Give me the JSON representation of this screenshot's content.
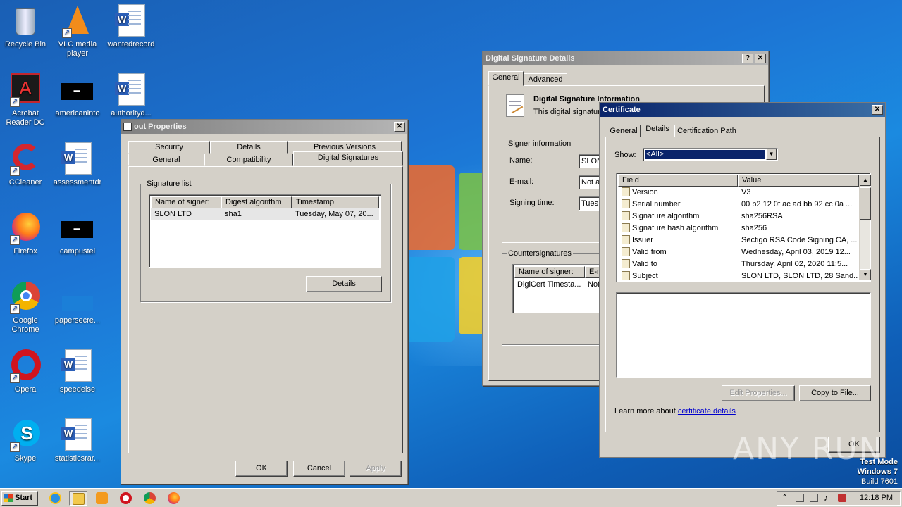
{
  "desktop": {
    "icons": [
      {
        "label": "Recycle Bin",
        "icon": "recycle-bin-icon"
      },
      {
        "label": "VLC media player",
        "icon": "vlc-icon"
      },
      {
        "label": "wantedrecord",
        "icon": "word-doc-icon"
      },
      {
        "label": "Acrobat Reader DC",
        "icon": "acrobat-icon"
      },
      {
        "label": "americaninto",
        "icon": "black-file-icon"
      },
      {
        "label": "authorityd...",
        "icon": "word-doc-icon"
      },
      {
        "label": "CCleaner",
        "icon": "ccleaner-icon"
      },
      {
        "label": "assessmentdr",
        "icon": "word-doc-icon"
      },
      {
        "label": "Firefox",
        "icon": "firefox-icon"
      },
      {
        "label": "campustel",
        "icon": "black-file-icon"
      },
      {
        "label": "Google Chrome",
        "icon": "chrome-icon"
      },
      {
        "label": "papersecre...",
        "icon": "blank-file-icon"
      },
      {
        "label": "Opera",
        "icon": "opera-icon"
      },
      {
        "label": "speedelse",
        "icon": "word-doc-icon"
      },
      {
        "label": "Skype",
        "icon": "skype-icon"
      },
      {
        "label": "statisticsrar...",
        "icon": "word-doc-icon"
      }
    ]
  },
  "props": {
    "title": "out Properties",
    "tabs_row1": [
      "Security",
      "Details",
      "Previous Versions"
    ],
    "tabs_row2": [
      "General",
      "Compatibility",
      "Digital Signatures"
    ],
    "sig_group": "Signature list",
    "columns": [
      "Name of signer:",
      "Digest algorithm",
      "Timestamp"
    ],
    "rows": [
      [
        "SLON LTD",
        "sha1",
        "Tuesday, May 07, 20..."
      ]
    ],
    "details_btn": "Details",
    "ok": "OK",
    "cancel": "Cancel",
    "apply": "Apply"
  },
  "dsd": {
    "title": "Digital Signature Details",
    "help": "?",
    "close": "X",
    "tabs": [
      "General",
      "Advanced"
    ],
    "info_title": "Digital Signature Information",
    "info_text": "This digital signature",
    "signer_group": "Signer information",
    "name_label": "Name:",
    "name_value": "SLON",
    "email_label": "E-mail:",
    "email_value": "Not av",
    "time_label": "Signing time:",
    "time_value": "Tues",
    "counter_group": "Countersignatures",
    "counter_cols": [
      "Name of signer:",
      "E-m"
    ],
    "counter_rows": [
      [
        "DigiCert Timesta...",
        "Not"
      ]
    ]
  },
  "cert": {
    "title": "Certificate",
    "close": "X",
    "tabs": [
      "General",
      "Details",
      "Certification Path"
    ],
    "show_label": "Show:",
    "show_value": "<All>",
    "cols": [
      "Field",
      "Value"
    ],
    "rows": [
      {
        "field": "Version",
        "value": "V3"
      },
      {
        "field": "Serial number",
        "value": "00 b2 12 0f ac ad bb 92 cc 0a ..."
      },
      {
        "field": "Signature algorithm",
        "value": "sha256RSA"
      },
      {
        "field": "Signature hash algorithm",
        "value": "sha256"
      },
      {
        "field": "Issuer",
        "value": "Sectigo RSA Code Signing CA, ..."
      },
      {
        "field": "Valid from",
        "value": "Wednesday, April 03, 2019 12..."
      },
      {
        "field": "Valid to",
        "value": "Thursday, April 02, 2020 11:5..."
      },
      {
        "field": "Subject",
        "value": "SLON LTD, SLON LTD, 28 Sand..."
      }
    ],
    "edit_btn": "Edit Properties...",
    "copy_btn": "Copy to File...",
    "learn_prefix": "Learn more about",
    "learn_link": "certificate details",
    "ok": "OK"
  },
  "taskbar": {
    "start": "Start",
    "clock": "12:18 PM",
    "apps": [
      "ie-icon",
      "explorer-icon",
      "media-player-icon",
      "opera-icon",
      "chrome-icon",
      "firefox-icon"
    ]
  },
  "watermark": {
    "line1": "Test Mode",
    "line2": "Windows 7",
    "line3": "Build 7601",
    "brand": "ANY RUN"
  }
}
